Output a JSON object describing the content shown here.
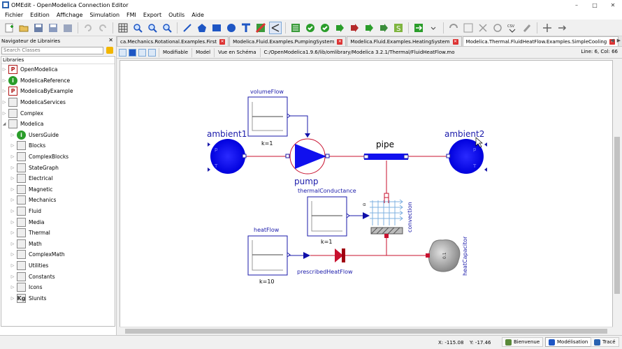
{
  "window": {
    "title": "OMEdit - OpenModelica Connection Editor"
  },
  "menu": [
    "Fichier",
    "Edition",
    "Affichage",
    "Simulation",
    "FMI",
    "Export",
    "Outils",
    "Aide"
  ],
  "library_pane": {
    "header": "Navigateur de Librairies",
    "search_placeholder": "Search Classes",
    "tree_title": "Libraries",
    "items": [
      {
        "label": "OpenModelica",
        "icon": "P",
        "level": 0
      },
      {
        "label": "ModelicaReference",
        "icon": "i",
        "level": 0
      },
      {
        "label": "ModelicaByExample",
        "icon": "P",
        "level": 0
      },
      {
        "label": "ModelicaServices",
        "icon": "",
        "level": 0
      },
      {
        "label": "Complex",
        "icon": "",
        "level": 0
      },
      {
        "label": "Modelica",
        "icon": "",
        "level": 0
      },
      {
        "label": "UsersGuide",
        "icon": "i",
        "level": 1
      },
      {
        "label": "Blocks",
        "icon": "",
        "level": 1
      },
      {
        "label": "ComplexBlocks",
        "icon": "",
        "level": 1
      },
      {
        "label": "StateGraph",
        "icon": "",
        "level": 1
      },
      {
        "label": "Electrical",
        "icon": "",
        "level": 1
      },
      {
        "label": "Magnetic",
        "icon": "",
        "level": 1
      },
      {
        "label": "Mechanics",
        "icon": "",
        "level": 1
      },
      {
        "label": "Fluid",
        "icon": "",
        "level": 1
      },
      {
        "label": "Media",
        "icon": "",
        "level": 1
      },
      {
        "label": "Thermal",
        "icon": "",
        "level": 1
      },
      {
        "label": "Math",
        "icon": "",
        "level": 1
      },
      {
        "label": "ComplexMath",
        "icon": "",
        "level": 1
      },
      {
        "label": "Utilities",
        "icon": "",
        "level": 1
      },
      {
        "label": "Constants",
        "icon": "",
        "level": 1
      },
      {
        "label": "Icons",
        "icon": "",
        "level": 1
      },
      {
        "label": "SIunits",
        "icon": "Kg",
        "level": 1
      }
    ]
  },
  "tabs": [
    {
      "label": "ca.Mechanics.Rotational.Examples.First",
      "active": false
    },
    {
      "label": "Modelica.Fluid.Examples.PumpingSystem",
      "active": false
    },
    {
      "label": "Modelica.Fluid.Examples.HeatingSystem",
      "active": false
    },
    {
      "label": "Modelica.Thermal.FluidHeatFlow.Examples.SimpleCooling",
      "active": true
    }
  ],
  "infobar": {
    "access": "Modifiable",
    "type": "Model",
    "view": "Vue en Schéma",
    "path": "C:/OpenModelica1.9.6/lib/omlibrary/Modelica 3.2.1/Thermal/FluidHeatFlow.mo",
    "position": "Line: 6, Col: 66"
  },
  "diagram": {
    "volumeFlow": {
      "name": "volumeFlow",
      "param": "k=1"
    },
    "ambient1": "ambient1",
    "ambient2": "ambient2",
    "pump": "pump",
    "pipe": "pipe",
    "thermalConductance": {
      "name": "thermalConductance",
      "param": "k=1"
    },
    "heatFlow": {
      "name": "heatFlow",
      "param": "k=10"
    },
    "prescribedHeatFlow": "prescribedHeatFlow",
    "convection": "convection",
    "heatCapacitor": "heatCapacitor",
    "capacitor_label": "0.1",
    "alpha_label": "α",
    "port_T": "T",
    "port_p": "p",
    "colors": {
      "component": "#0000ff",
      "connection": "#c8102e",
      "thermal": "#cc0000"
    }
  },
  "status": {
    "x": "X: -115.08",
    "y": "Y: -17.46",
    "welcome": "Bienvenue",
    "modeling": "Modélisation",
    "plot": "Tracé"
  }
}
